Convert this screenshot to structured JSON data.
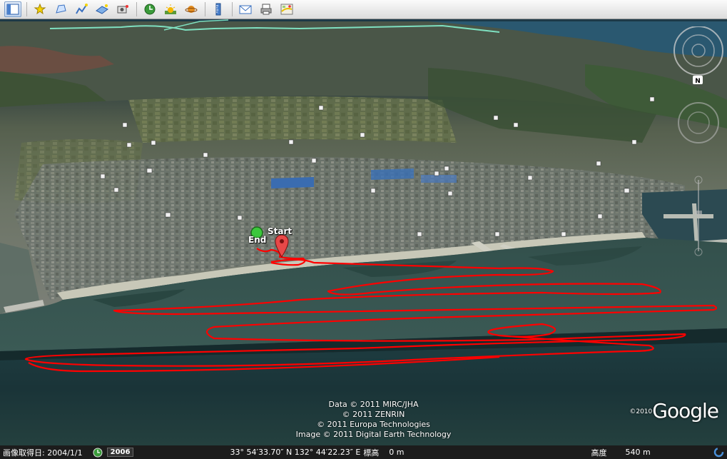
{
  "toolbar": {
    "buttons": [
      {
        "name": "sidebar-toggle-button",
        "icon": "sidebar-icon",
        "active": true
      },
      {
        "name": "add-placemark-button",
        "icon": "pushpin-icon"
      },
      {
        "name": "add-polygon-button",
        "icon": "polygon-icon"
      },
      {
        "name": "add-path-button",
        "icon": "path-icon"
      },
      {
        "name": "add-image-overlay-button",
        "icon": "image-overlay-icon"
      },
      {
        "name": "record-tour-button",
        "icon": "camera-icon"
      },
      {
        "name": "historical-imagery-button",
        "icon": "clock-icon"
      },
      {
        "name": "sunlight-button",
        "icon": "sun-icon"
      },
      {
        "name": "switch-planet-button",
        "icon": "planet-icon"
      },
      {
        "name": "ruler-button",
        "icon": "ruler-icon"
      },
      {
        "name": "email-button",
        "icon": "envelope-icon"
      },
      {
        "name": "print-button",
        "icon": "printer-icon"
      },
      {
        "name": "view-in-maps-button",
        "icon": "map-icon"
      }
    ]
  },
  "placemarks": {
    "start_label": "Start",
    "end_label": "End"
  },
  "attribution": {
    "lines": [
      "Data © 2011 MIRC/JHA",
      "© 2011 ZENRIN",
      "© 2011 Europa Technologies",
      "Image © 2011 Digital Earth Technology"
    ]
  },
  "logo": {
    "year": "©2010",
    "text": "Google"
  },
  "navigation": {
    "north_label": "N"
  },
  "status": {
    "imagery_date": "画像取得日: 2004/1/1",
    "historical_year": "2006",
    "coordinates": "33° 54′33.70″ N 132° 44′22.23″ E",
    "elevation_label": "標高",
    "elevation_value": "0 m",
    "altitude_label": "高度",
    "altitude_value": "540 m"
  },
  "colors": {
    "track": "#ff0000",
    "toolbar_bg": "#e8e8e8",
    "status_bg": "#1c1c1c"
  }
}
